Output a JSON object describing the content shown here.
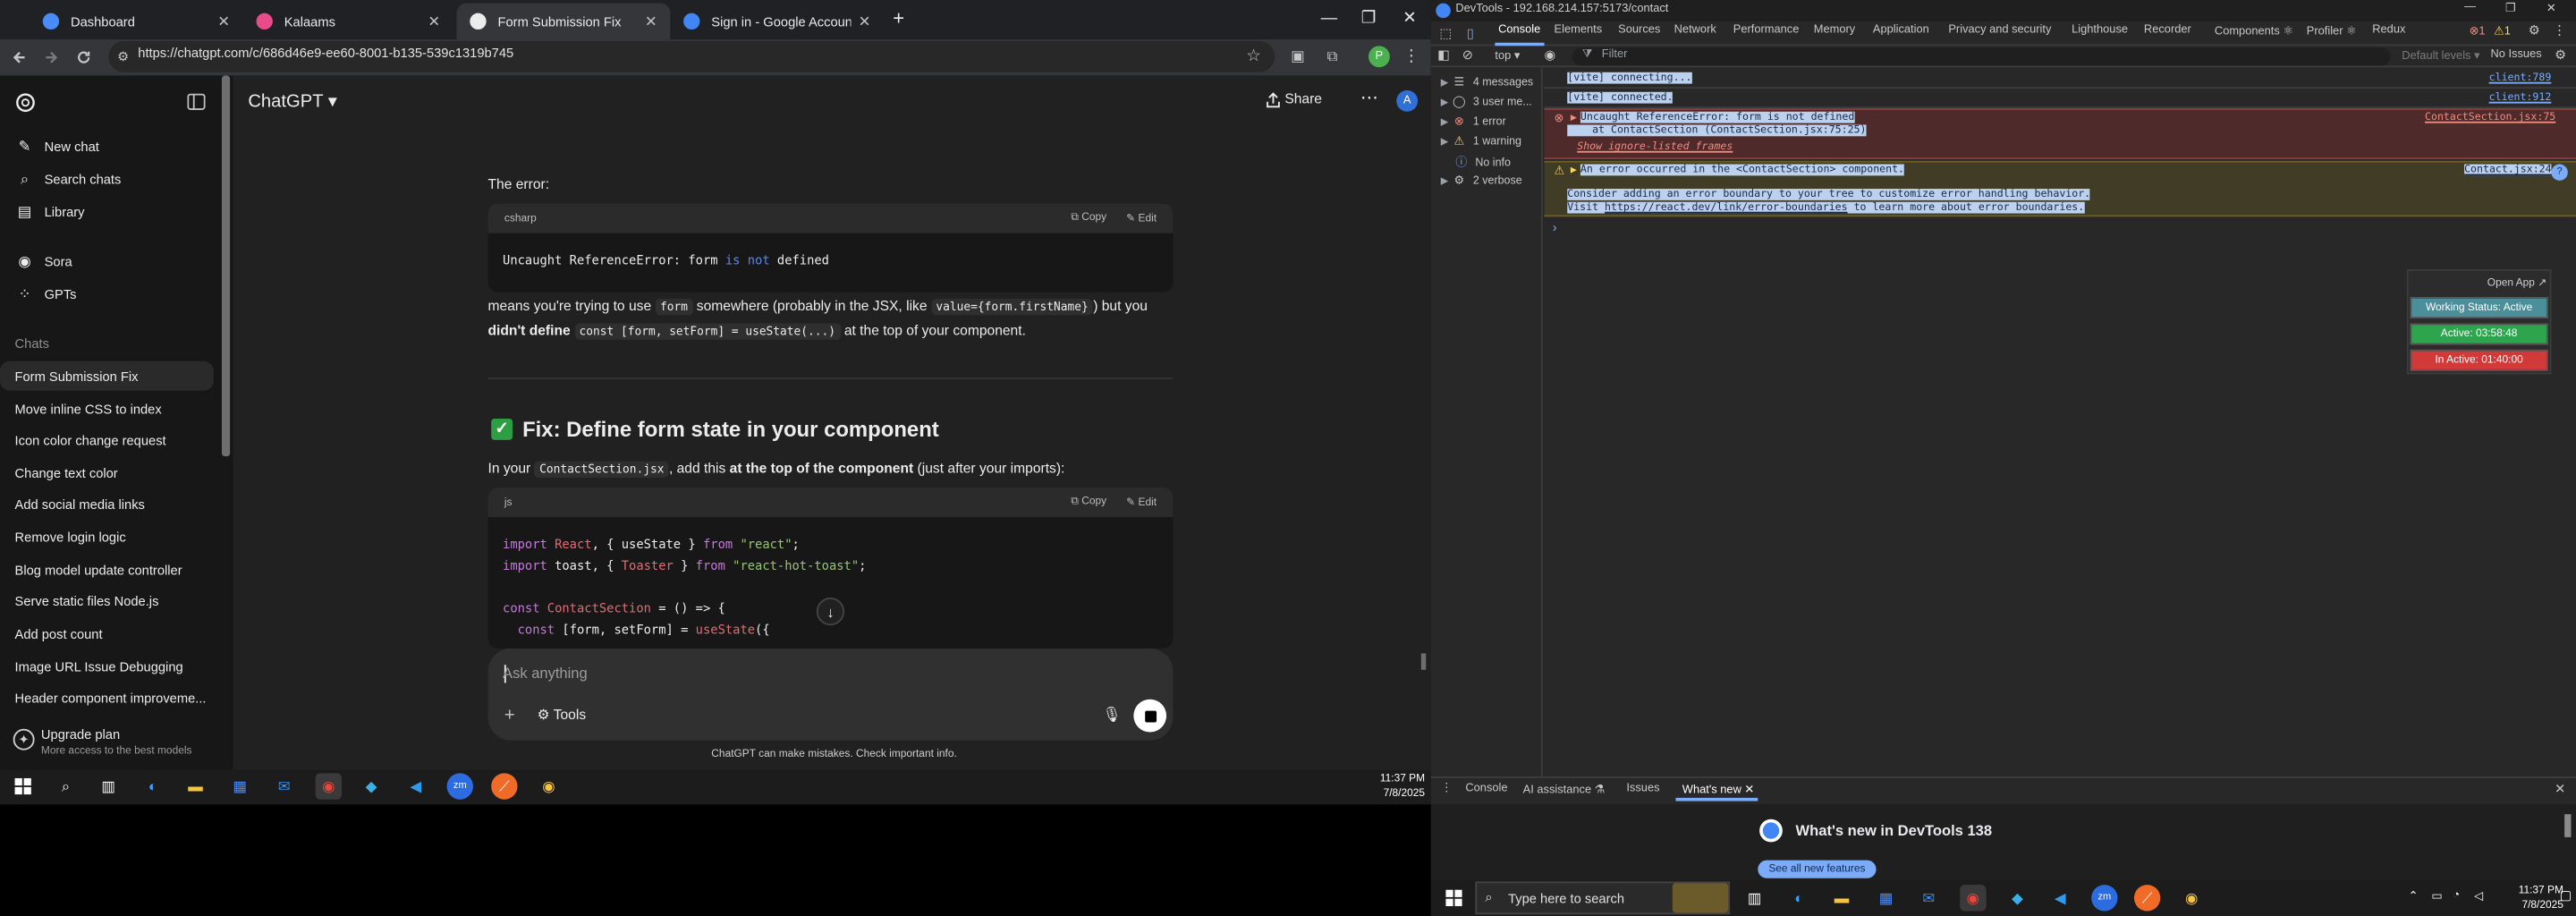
{
  "browser": {
    "tabs": [
      {
        "title": "Dashboard",
        "fav": "#4a8cf7",
        "close": "✕"
      },
      {
        "title": "Kalaams",
        "fav": "#e84a8a",
        "close": "✕"
      },
      {
        "title": "Form Submission Fix",
        "fav": "#ececec",
        "close": "✕"
      },
      {
        "title": "Sign in - Google Accounts",
        "fav": "#4285f4",
        "close": "✕"
      }
    ],
    "new_tab": "+",
    "url": "https://chatgpt.com/c/686d46e9-ee60-8001-b135-539c1319b745",
    "window": {
      "min": "—",
      "max": "❐",
      "close": "✕"
    },
    "icons": {
      "back": "back-arrow-icon",
      "forward": "forward-arrow-icon",
      "reload": "reload-icon",
      "site": "site-info-icon",
      "star": "bookmark-star-icon",
      "extensions": "extensions-icon",
      "profile": "profile-icon",
      "menu": "kebab-menu-icon"
    },
    "profile_initial": "P"
  },
  "sidebar": {
    "top": [
      {
        "label": "New chat",
        "icon": "✎"
      },
      {
        "label": "Search chats",
        "icon": "⌕"
      },
      {
        "label": "Library",
        "icon": "▤"
      },
      {
        "label": "Sora",
        "icon": "◉"
      },
      {
        "label": "GPTs",
        "icon": "⁘"
      }
    ],
    "chats_heading": "Chats",
    "chats": [
      "Form Submission Fix",
      "Move inline CSS to index",
      "Icon color change request",
      "Change text color",
      "Add social media links",
      "Remove login logic",
      "Blog model update controller",
      "Serve static files Node.js",
      "Add post count",
      "Image URL Issue Debugging",
      "Header component improveme..."
    ],
    "upgrade_title": "Upgrade plan",
    "upgrade_sub": "More access to the best models"
  },
  "header": {
    "title": "ChatGPT ▾",
    "share": "Share",
    "avatar": "A"
  },
  "content": {
    "error_label": "The error:",
    "block1": {
      "lang": "csharp",
      "copy": "Copy",
      "edit": "Edit",
      "code": "Uncaught ReferenceError: form is not defined"
    },
    "p1a": "means you're trying to use ",
    "p1code1": "form",
    "p1b": " somewhere (probably in the JSX, like ",
    "p1code2": "value={form.firstName}",
    "p1c": ") but you",
    "p2a": "didn't define",
    "p2code": "const [form, setForm] = useState(...)",
    "p2b": " at the top of your component.",
    "fix_heading": "Fix: Define form state in your component",
    "p3a": "In your ",
    "p3code": "ContactSection.jsx",
    "p3b": ", add this ",
    "p3bold": "at the top of the component",
    "p3c": " (just after your imports):",
    "block2": {
      "lang": "js",
      "copy": "Copy",
      "edit": "Edit"
    },
    "ask_placeholder": "Ask anything",
    "tools": "Tools",
    "disclaimer": "ChatGPT can make mistakes. Check important info."
  },
  "taskbar_left": {
    "time": "11:37 PM",
    "date": "7/8/2025"
  },
  "devtools": {
    "title": "DevTools - 192.168.214.157:5173/contact",
    "tabs": [
      "Console",
      "Elements",
      "Sources",
      "Network",
      "Performance",
      "Memory",
      "Application",
      "Privacy and security",
      "Lighthouse",
      "Recorder",
      "Components ⚛",
      "Profiler ⚛",
      "Redux"
    ],
    "badge_errors": "1",
    "badge_warnings": "1",
    "context": "top ▾",
    "filter_placeholder": "Filter",
    "levels": "Default levels ▾",
    "issues": "No Issues",
    "sidebar": [
      {
        "label": "4 messages",
        "icon": "☰"
      },
      {
        "label": "3 user me...",
        "icon": "◯"
      },
      {
        "label": "1 error",
        "icon": "⊗"
      },
      {
        "label": "1 warning",
        "icon": "⚠"
      },
      {
        "label": "No info",
        "icon": "ⓘ"
      },
      {
        "label": "2 verbose",
        "icon": "⚙"
      }
    ],
    "messages": {
      "m1": "[vite] connecting...",
      "m1src": "client:789",
      "m2": "[vite] connected.",
      "m2src": "client:912",
      "err1": "Uncaught ReferenceError: form is not defined",
      "err2": "    at ContactSection (ContactSection.jsx:75:25)",
      "err_src": "ContactSection.jsx:75",
      "err_link": "Show ignore-listed frames",
      "warn1": "An error occurred in the <ContactSection> component.",
      "warn_src": "Contact.jsx:24",
      "warn2": "Consider adding an error boundary to your tree to customize error handling behavior.",
      "warn3a": "Visit ",
      "warn3link": "https://react.dev/link/error-boundaries",
      "warn3b": " to learn more about error boundaries.",
      "prompt": "›"
    },
    "overlay": {
      "open": "Open App ↗",
      "working": "Working Status: Active",
      "active": "Active: 03:58:48",
      "inactive": "In Active: 01:40:00"
    },
    "drawer": {
      "tabs": [
        "Console",
        "AI assistance ⚗",
        "Issues",
        "What's new ✕"
      ],
      "whatsnew_title": "What's new in DevTools 138",
      "see_all": "See all new features"
    }
  },
  "taskbar_right": {
    "search": "Type here to search",
    "time": "11:37 PM",
    "date": "7/8/2025"
  }
}
